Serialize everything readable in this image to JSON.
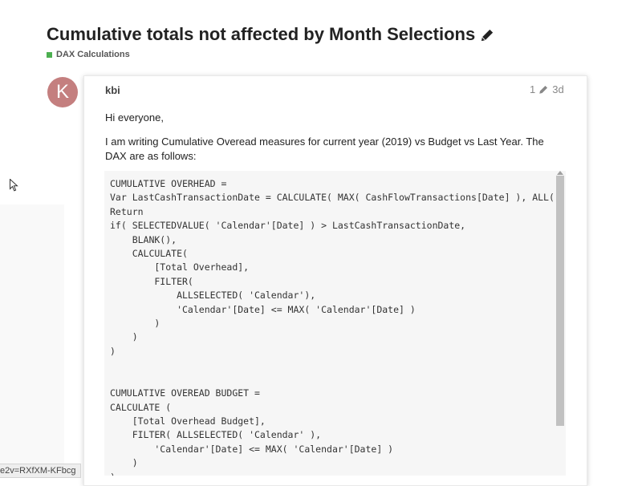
{
  "topic": {
    "title": "Cumulative totals not affected by Month Selections",
    "category": "DAX Calculations",
    "category_color": "#4caf50"
  },
  "post": {
    "avatar_letter": "K",
    "avatar_color": "#c47f7f",
    "username": "kbi",
    "edit_count": "1",
    "age": "3d",
    "paragraphs": [
      "Hi everyone,",
      "I am writing Cumulative Overead measures for current year (2019) vs Budget vs Last Year. The DAX are as follows:"
    ],
    "code": "CUMULATIVE OVERHEAD =\nVar LastCashTransactionDate = CALCULATE( MAX( CashFlowTransactions[Date] ), ALL(\nReturn\nif( SELECTEDVALUE( 'Calendar'[Date] ) > LastCashTransactionDate,\n    BLANK(),\n    CALCULATE(\n        [Total Overhead],\n        FILTER(\n            ALLSELECTED( 'Calendar'),\n            'Calendar'[Date] <= MAX( 'Calendar'[Date] )\n        )\n    )\n)\n\n\nCUMULATIVE OVEREAD BUDGET =\nCALCULATE (\n    [Total Overhead Budget],\n    FILTER( ALLSELECTED( 'Calendar' ),\n        'Calendar'[Date] <= MAX( 'Calendar'[Date] )\n    )\n)"
  },
  "status_bar": {
    "url_fragment": "e2v=RXfXM-KFbcg"
  }
}
